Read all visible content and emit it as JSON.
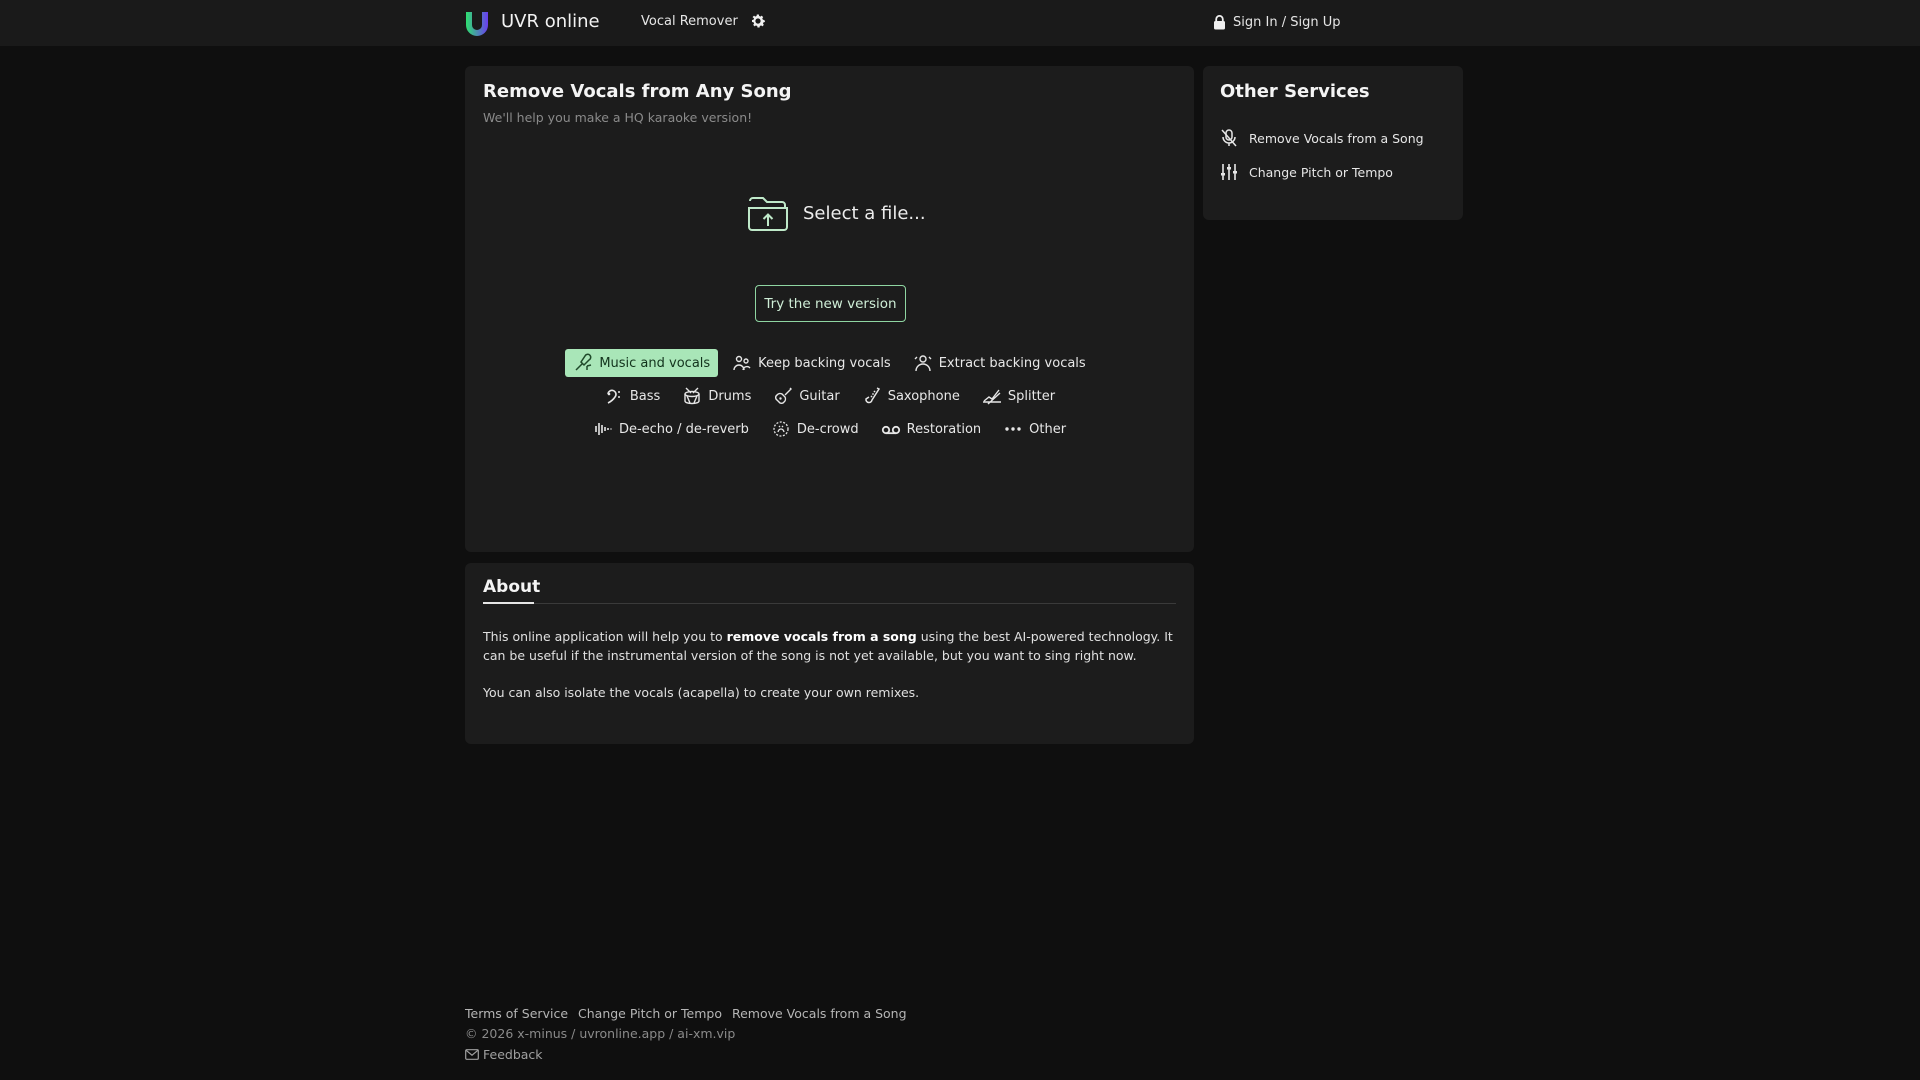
{
  "header": {
    "brand": "UVR online",
    "nav_vocal_remover": "Vocal Remover",
    "sign_in": "Sign In / Sign Up"
  },
  "main": {
    "title": "Remove Vocals from Any Song",
    "subtitle": "We'll help you make a HQ karaoke version!",
    "select_file": "Select a file...",
    "try_new_version": "Try the new version",
    "modes_row1": [
      {
        "label": "Music and vocals",
        "icon": "mic-music-icon",
        "active": true
      },
      {
        "label": "Keep backing vocals",
        "icon": "group-singers-icon",
        "active": false
      },
      {
        "label": "Extract backing vocals",
        "icon": "backing-singers-icon",
        "active": false
      }
    ],
    "modes_row2": [
      {
        "label": "Bass",
        "icon": "bass-clef-icon"
      },
      {
        "label": "Drums",
        "icon": "drum-icon"
      },
      {
        "label": "Guitar",
        "icon": "guitar-icon"
      },
      {
        "label": "Saxophone",
        "icon": "saxophone-icon"
      },
      {
        "label": "Splitter",
        "icon": "splitter-icon"
      }
    ],
    "modes_row3": [
      {
        "label": "De-echo / de-reverb",
        "icon": "echo-icon"
      },
      {
        "label": "De-crowd",
        "icon": "crowd-icon"
      },
      {
        "label": "Restoration",
        "icon": "tape-icon"
      },
      {
        "label": "Other",
        "icon": "more-dots-icon"
      }
    ]
  },
  "about": {
    "title": "About",
    "p1_before": "This online application will help you to ",
    "p1_bold": "remove vocals from a song",
    "p1_after": " using the best AI-powered technology. It can be useful if the instrumental version of the song is not yet available, but you want to sing right now.",
    "p2": "You can also isolate the vocals (acapella) to create your own remixes."
  },
  "side": {
    "title": "Other Services",
    "items": [
      {
        "label": "Remove Vocals from a Song",
        "icon": "mic-off-icon"
      },
      {
        "label": "Change Pitch or Tempo",
        "icon": "sliders-icon"
      }
    ]
  },
  "footer": {
    "links": [
      "Terms of Service",
      "Change Pitch or Tempo",
      "Remove Vocals from a Song"
    ],
    "copyright": "© 2026 x-minus / uvronline.app / ai-xm.vip",
    "feedback": "Feedback"
  },
  "colors": {
    "background": "#0f0f0f",
    "panel": "#1c1c1c",
    "accent": "#a9e6b8",
    "accent_border": "#8fd6a2"
  }
}
